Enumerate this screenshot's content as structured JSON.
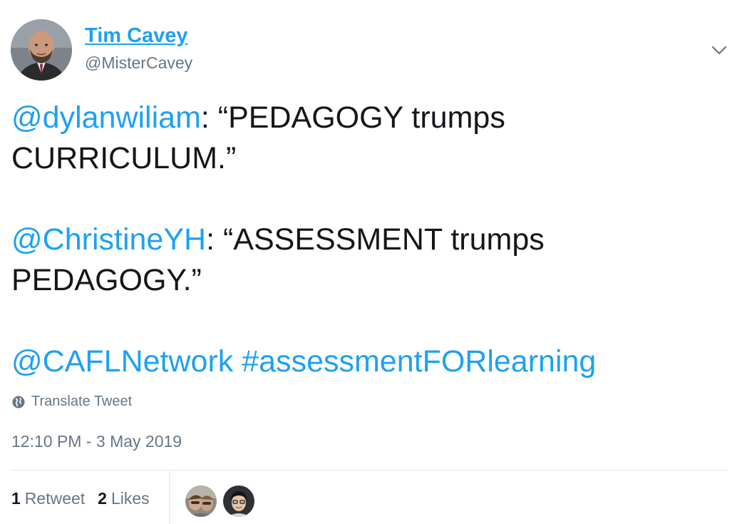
{
  "author": {
    "display_name": "Tim Cavey",
    "handle": "@MisterCavey"
  },
  "tweet": {
    "paragraphs": [
      {
        "mention": "@dylanwiliam",
        "text": ": “PEDAGOGY trumps CURRICULUM.”"
      },
      {
        "mention": "@ChristineYH",
        "text": ": “ASSESSMENT trumps PEDAGOGY.”"
      },
      {
        "mention": "@CAFLNetwork",
        "hashtag": "#assessmentFORlearning"
      }
    ],
    "translate_label": "Translate Tweet",
    "timestamp": "12:10 PM - 3 May 2019"
  },
  "stats": {
    "retweets_count": "1",
    "retweets_label": "Retweet",
    "likes_count": "2",
    "likes_label": "Likes"
  },
  "icons": {
    "menu": "chevron-down-icon",
    "translate": "globe-icon"
  },
  "colors": {
    "link": "#1da1f2",
    "text": "#14171a",
    "muted": "#657786",
    "divider": "#e1e8ed"
  }
}
